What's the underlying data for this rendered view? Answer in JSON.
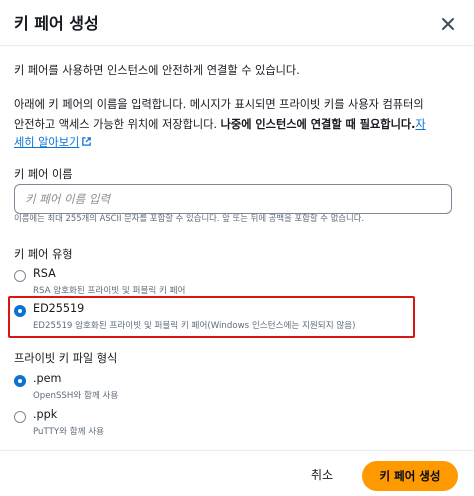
{
  "dialog": {
    "title": "키 페어 생성"
  },
  "intro": {
    "line1": "키 페어를 사용하면 인스턴스에 안전하게 연결할 수 있습니다.",
    "line2": "아래에 키 페어의 이름을 입력합니다. 메시지가 표시되면 프라이빗 키를 사용자 컴퓨터의",
    "line3_plain": "안전하고 액세스 가능한 위치에 저장합니다. ",
    "line3_bold": "나중에 인스턴스에 연결할 때 필요합니다.",
    "link_part1": "자",
    "link_part2": "세히 알아보기"
  },
  "key_name": {
    "label": "키 페어 이름",
    "placeholder": "키 페어 이름 입력",
    "value": "",
    "hint": "이름에는 최대 255개의 ASCII 문자를 포함할 수 있습니다. 앞 또는 뒤에 공백을 포함할 수 없습니다."
  },
  "key_type": {
    "label": "키 페어 유형",
    "options": [
      {
        "label": "RSA",
        "description": "RSA 암호화된 프라이빗 및 퍼블릭 키 페어",
        "selected": false
      },
      {
        "label": "ED25519",
        "description": "ED25519 암호화된 프라이빗 및 퍼블릭 키 페어(Windows 인스턴스에는 지원되지 않음)",
        "selected": true
      }
    ]
  },
  "file_format": {
    "label": "프라이빗 키 파일 형식",
    "options": [
      {
        "label": ".pem",
        "description": "OpenSSH와 함께 사용",
        "selected": true
      },
      {
        "label": ".ppk",
        "description": "PuTTY와 함께 사용",
        "selected": false
      }
    ]
  },
  "footer": {
    "cancel_label": "취소",
    "create_label": "키 페어 생성"
  },
  "colors": {
    "primary": "#ff9900",
    "link": "#0972d3",
    "radio_selected": "#0972d3",
    "highlight": "#d91515"
  }
}
